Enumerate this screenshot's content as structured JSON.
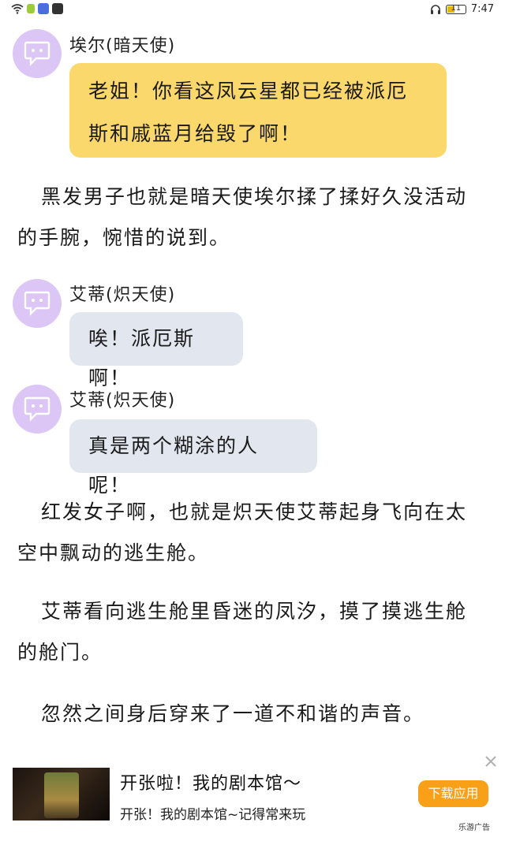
{
  "status_bar": {
    "time": "7:47",
    "battery": "11"
  },
  "messages": [
    {
      "speaker": "埃尔(暗天使)",
      "lines": [
        "老姐！你看这凤云星都已经被派厄",
        "斯和戚蓝月给毁了啊！"
      ]
    },
    {
      "speaker": "艾蒂(炽天使)",
      "lines": [
        "唉！派厄斯啊！"
      ]
    },
    {
      "speaker": "艾蒂(炽天使)",
      "lines": [
        "真是两个糊涂的人呢！"
      ]
    }
  ],
  "narration": [
    "黑发男子也就是暗天使埃尔揉了揉好久没活动的手腕，惋惜的说到。",
    "红发女子啊，也就是炽天使艾蒂起身飞向在太空中飘动的逃生舱。",
    "艾蒂看向逃生舱里昏迷的凤汐，摸了摸逃生舱的舱门。",
    "忽然之间身后穿来了一道不和谐的声音。"
  ],
  "ad": {
    "title": "开张啦！我的剧本馆～",
    "subtitle": "开张！我的剧本馆~记得常来玩",
    "button": "下载应用",
    "source": "乐游广告"
  },
  "colors": {
    "bubble_yellow": "#fbd86b",
    "bubble_gray": "#e2e7ef",
    "avatar": "#dcc6f5",
    "ad_button": "#f7a018"
  }
}
